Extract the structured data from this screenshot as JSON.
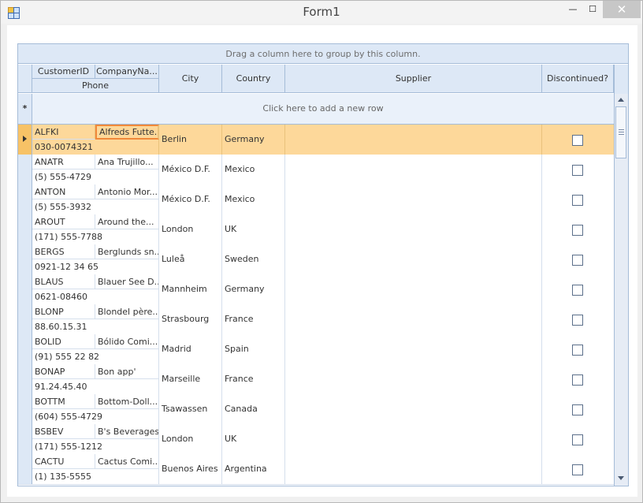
{
  "window": {
    "title": "Form1",
    "close_glyph": "✕",
    "max_glyph": "☐",
    "min_glyph": "—"
  },
  "group_panel": {
    "text": "Drag a column here to group by this column."
  },
  "columns": {
    "customer_id": "CustomerID",
    "company_name": "CompanyNa...",
    "phone": "Phone",
    "city": "City",
    "country": "Country",
    "supplier": "Supplier",
    "discontinued": "Discontinued?"
  },
  "new_row": {
    "marker": "*",
    "text": "Click here to add a new row"
  },
  "rows": [
    {
      "id": "ALFKI",
      "company": "Alfreds Futte...",
      "phone": "030-0074321",
      "city": "Berlin",
      "country": "Germany",
      "supplier": "",
      "discontinued": false
    },
    {
      "id": "ANATR",
      "company": "Ana Trujillo...",
      "phone": "(5) 555-4729",
      "city": "México D.F.",
      "country": "Mexico",
      "supplier": "",
      "discontinued": false
    },
    {
      "id": "ANTON",
      "company": "Antonio Mor...",
      "phone": "(5) 555-3932",
      "city": "México D.F.",
      "country": "Mexico",
      "supplier": "",
      "discontinued": false
    },
    {
      "id": "AROUT",
      "company": "Around the...",
      "phone": "(171) 555-7788",
      "city": "London",
      "country": "UK",
      "supplier": "",
      "discontinued": false
    },
    {
      "id": "BERGS",
      "company": "Berglunds sn...",
      "phone": "0921-12 34 65",
      "city": "Luleå",
      "country": "Sweden",
      "supplier": "",
      "discontinued": false
    },
    {
      "id": "BLAUS",
      "company": "Blauer See D...",
      "phone": "0621-08460",
      "city": "Mannheim",
      "country": "Germany",
      "supplier": "",
      "discontinued": false
    },
    {
      "id": "BLONP",
      "company": "Blondel père...",
      "phone": "88.60.15.31",
      "city": "Strasbourg",
      "country": "France",
      "supplier": "",
      "discontinued": false
    },
    {
      "id": "BOLID",
      "company": "Bólido Comi...",
      "phone": "(91) 555 22 82",
      "city": "Madrid",
      "country": "Spain",
      "supplier": "",
      "discontinued": false
    },
    {
      "id": "BONAP",
      "company": "Bon app'",
      "phone": "91.24.45.40",
      "city": "Marseille",
      "country": "France",
      "supplier": "",
      "discontinued": false
    },
    {
      "id": "BOTTM",
      "company": "Bottom-Doll...",
      "phone": "(604) 555-4729",
      "city": "Tsawassen",
      "country": "Canada",
      "supplier": "",
      "discontinued": false
    },
    {
      "id": "BSBEV",
      "company": "B's Beverages",
      "phone": "(171) 555-1212",
      "city": "London",
      "country": "UK",
      "supplier": "",
      "discontinued": false
    },
    {
      "id": "CACTU",
      "company": "Cactus Comi...",
      "phone": "(1) 135-5555",
      "city": "Buenos Aires",
      "country": "Argentina",
      "supplier": "",
      "discontinued": false
    }
  ],
  "colors": {
    "selected_row": "#fdd89a",
    "focus_border": "#f0883a",
    "header_bg": "#dde8f6",
    "grid_line": "#a5bcd8"
  }
}
